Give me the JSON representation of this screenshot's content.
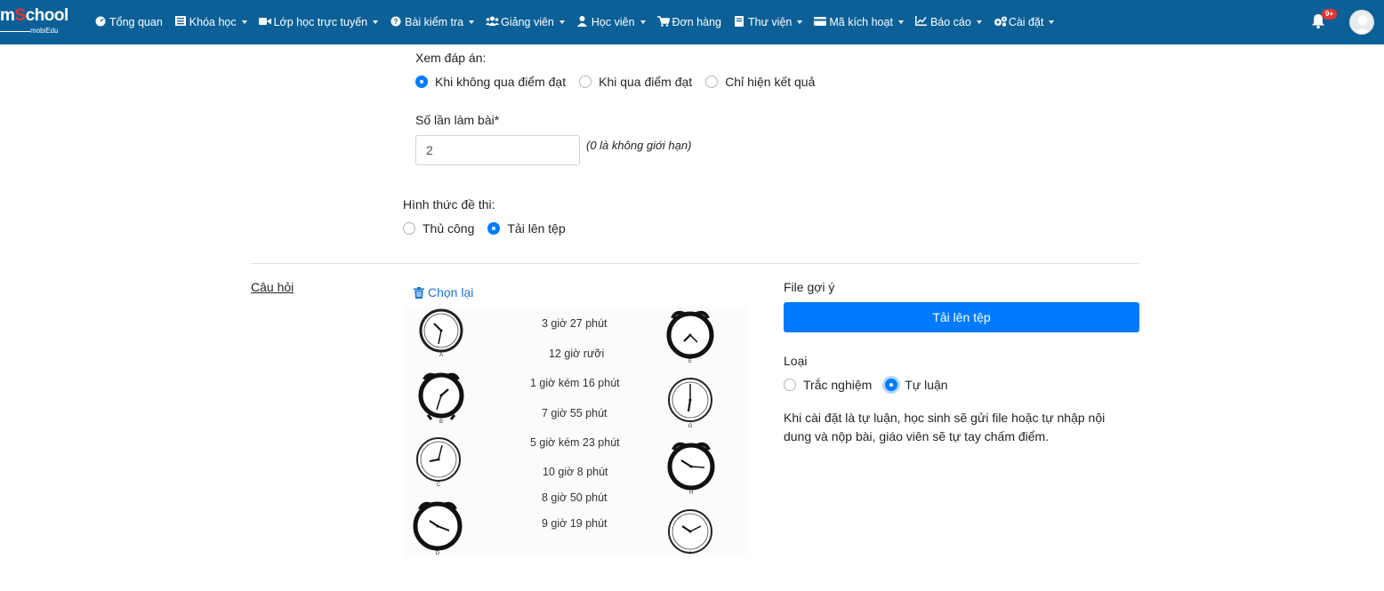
{
  "nav": {
    "logo_main": "mSchool",
    "logo_sub": "mobiEdu",
    "items": [
      {
        "label": "Tổng quan",
        "icon": "dashboard-icon",
        "dropdown": false
      },
      {
        "label": "Khóa học",
        "icon": "list-icon",
        "dropdown": true
      },
      {
        "label": "Lớp học trực tuyến",
        "icon": "video-icon",
        "dropdown": true
      },
      {
        "label": "Bài kiểm tra",
        "icon": "question-circle-icon",
        "dropdown": true
      },
      {
        "label": "Giảng viên",
        "icon": "users-icon",
        "dropdown": true
      },
      {
        "label": "Học viên",
        "icon": "user-icon",
        "dropdown": true
      },
      {
        "label": "Đơn hàng",
        "icon": "cart-icon",
        "dropdown": false
      },
      {
        "label": "Thư viện",
        "icon": "book-icon",
        "dropdown": true
      },
      {
        "label": "Mã kích hoạt",
        "icon": "credit-card-icon",
        "dropdown": true
      },
      {
        "label": "Báo cáo",
        "icon": "chart-line-icon",
        "dropdown": true
      },
      {
        "label": "Cài đặt",
        "icon": "cogs-icon",
        "dropdown": true
      }
    ],
    "notification_badge": "9+"
  },
  "form": {
    "view_answer": {
      "label": "Xem đáp án:",
      "options": [
        "Khi không qua điểm đạt",
        "Khi qua điểm đạt",
        "Chỉ hiện kết quả"
      ],
      "selected": 0
    },
    "attempts": {
      "label": "Số lần làm bài*",
      "value": "2",
      "hint": "(0 là không giới hạn)"
    },
    "exam_format": {
      "label": "Hình thức đề thi:",
      "options": [
        "Thủ công",
        "Tải lên tệp"
      ],
      "selected": 1
    }
  },
  "question": {
    "title": "Câu hỏi",
    "reselect_label": "Chọn lại",
    "worksheet": {
      "times": [
        "3 giờ 27 phút",
        "12 giờ rưỡi",
        "1 giờ kém 16 phút",
        "7 giờ 55 phút",
        "5 giờ kém 23 phút",
        "10 giờ 8 phút",
        "8 giờ 50 phút",
        "9 giờ 19 phút"
      ],
      "clock_letters": [
        "A",
        "B",
        "C",
        "D",
        "E",
        "G",
        "H",
        "I"
      ]
    }
  },
  "right_panel": {
    "file_hint_label": "File gợi ý",
    "upload_button": "Tải lên tệp",
    "type_label": "Loại",
    "type_options": [
      "Trắc nghiệm",
      "Tự luận"
    ],
    "type_selected": 1,
    "description": "Khi cài đặt là tự luận, học sinh sẽ gửi file hoặc tự nhập nội dung và nộp bài, giáo viên sẽ tự tay chấm điểm."
  },
  "colors": {
    "navbar": "#0c6098",
    "primary": "#007bff",
    "link": "#1a73d9",
    "badge": "#e3342f"
  }
}
